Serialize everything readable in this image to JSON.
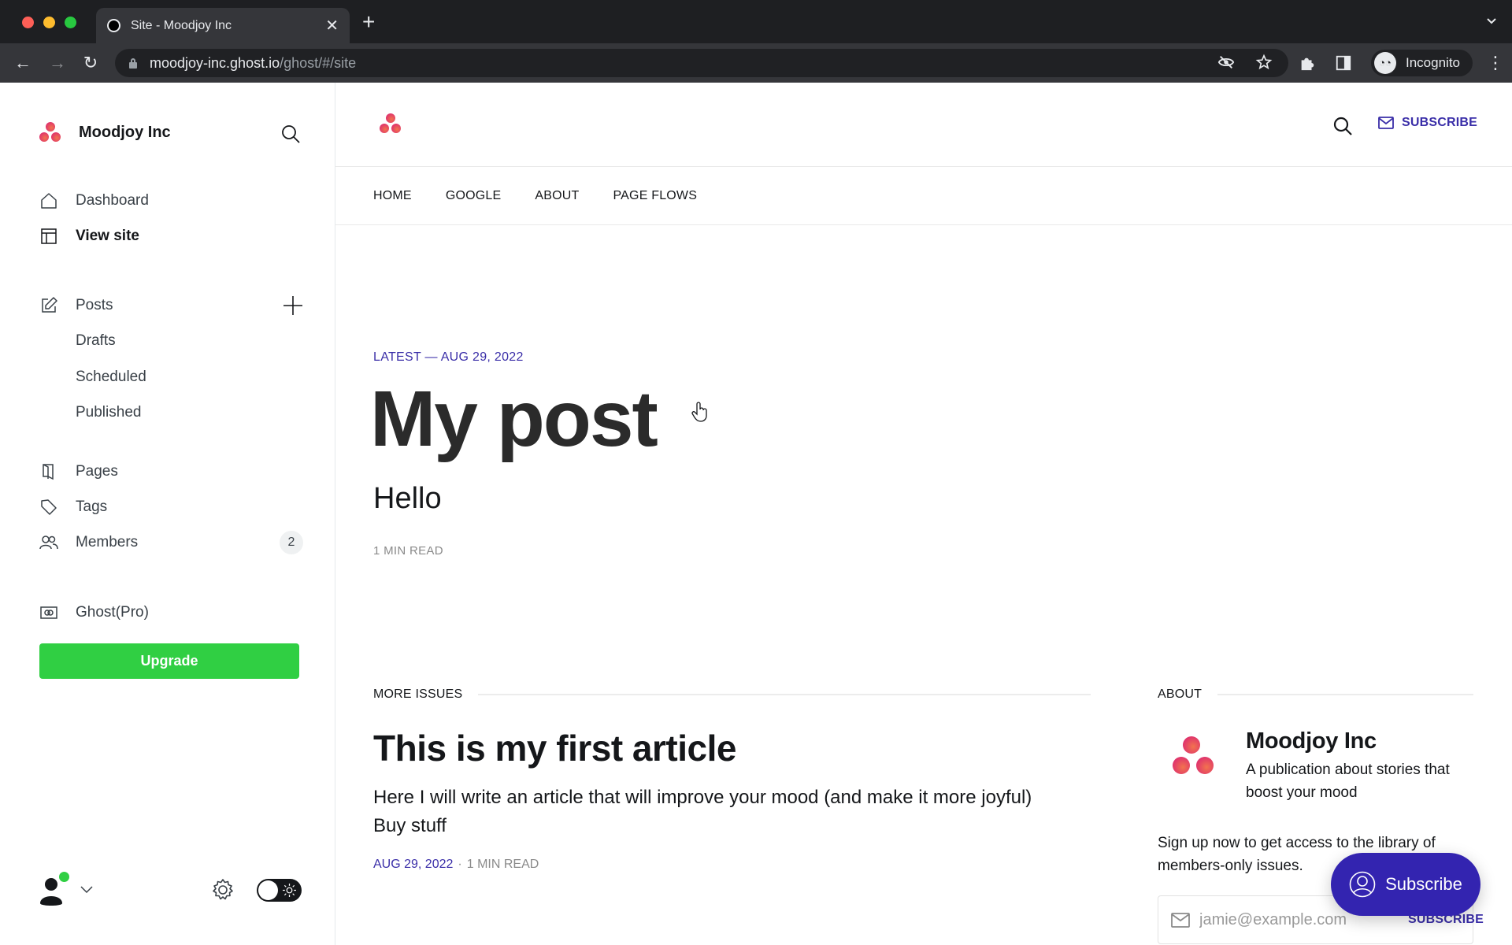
{
  "browser": {
    "tab_title": "Site - Moodjoy Inc",
    "url_host": "moodjoy-inc.ghost.io",
    "url_path": "/ghost/#/site",
    "profile_label": "Incognito"
  },
  "sidebar": {
    "site_title": "Moodjoy Inc",
    "items": [
      {
        "label": "Dashboard",
        "icon": "home-icon"
      },
      {
        "label": "View site",
        "icon": "layout-icon",
        "active": true
      },
      {
        "label": "Posts",
        "icon": "edit-icon"
      },
      {
        "label": "Drafts"
      },
      {
        "label": "Scheduled"
      },
      {
        "label": "Published"
      },
      {
        "label": "Pages",
        "icon": "pages-icon"
      },
      {
        "label": "Tags",
        "icon": "tag-icon"
      },
      {
        "label": "Members",
        "icon": "members-icon",
        "count": "2"
      },
      {
        "label": "Ghost(Pro)",
        "icon": "ghost-pro-icon"
      }
    ],
    "upgrade_label": "Upgrade"
  },
  "site": {
    "nav": [
      "HOME",
      "GOOGLE",
      "ABOUT",
      "PAGE FLOWS"
    ],
    "subscribe_label": "SUBSCRIBE",
    "latest": {
      "label": "LATEST — AUG 29, 2022",
      "title": "My post",
      "excerpt": "Hello",
      "meta": "1 MIN READ"
    },
    "more_issues": {
      "heading": "MORE ISSUES",
      "article": {
        "title": "This is my first article",
        "excerpt_line1": "Here I will write an article that will improve your mood (and make it more joyful)",
        "excerpt_line2": "Buy stuff",
        "date": "AUG 29, 2022",
        "separator": "·",
        "read_time": "1 MIN READ"
      }
    },
    "about": {
      "heading": "ABOUT",
      "name": "Moodjoy Inc",
      "description": "A publication about stories that boost your mood",
      "signup_text": "Sign up now to get access to the library of members-only issues.",
      "email_placeholder": "jamie@example.com",
      "submit_label": "SUBSCRIBE"
    },
    "portal_button_label": "Subscribe"
  },
  "colors": {
    "accent": "#3a2ea8",
    "portal": "#3324b0",
    "upgrade": "#30cf43",
    "brand_pink": "#e0356c"
  }
}
